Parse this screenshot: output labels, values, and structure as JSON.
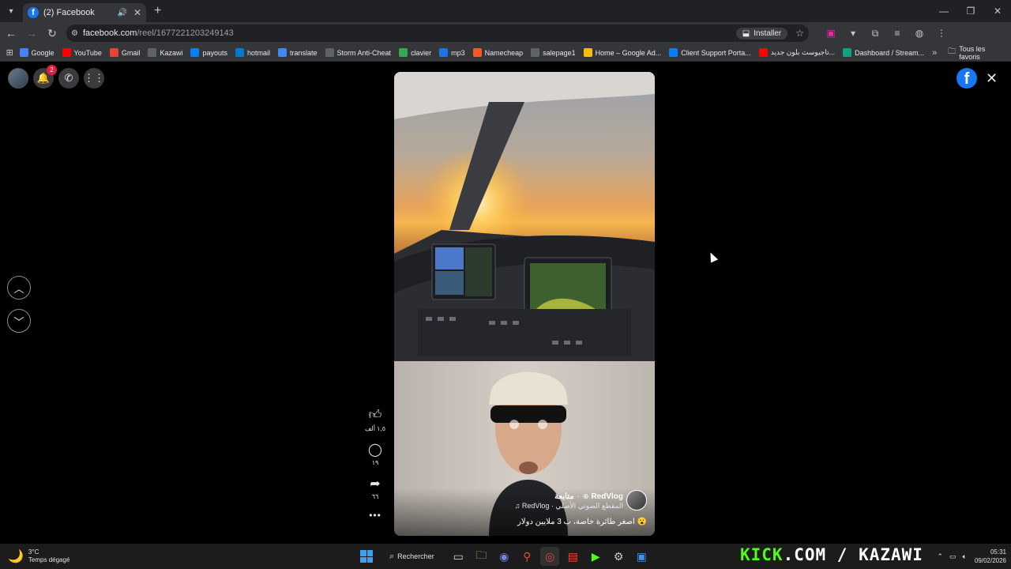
{
  "browser": {
    "tab_title": "(2) Facebook",
    "url_domain": "facebook.com",
    "url_path": "/reel/1677221203249143",
    "install_label": "Installer"
  },
  "bookmarks": {
    "items": [
      {
        "label": "Google",
        "color": "#4285f4"
      },
      {
        "label": "YouTube",
        "color": "#ff0000"
      },
      {
        "label": "Gmail",
        "color": "#ea4335"
      },
      {
        "label": "Kazawi",
        "color": "#5f6368"
      },
      {
        "label": "payouts",
        "color": "#0081fb"
      },
      {
        "label": "hotmail",
        "color": "#0078d4"
      },
      {
        "label": "translate",
        "color": "#4285f4"
      },
      {
        "label": "Storm Anti-Cheat",
        "color": "#5f6368"
      },
      {
        "label": "clavier",
        "color": "#34a853"
      },
      {
        "label": "mp3",
        "color": "#1a73e8"
      },
      {
        "label": "Namecheap",
        "color": "#ff5722"
      },
      {
        "label": "salepage1",
        "color": "#5f6368"
      },
      {
        "label": "Home – Google Ad...",
        "color": "#fbbc04"
      },
      {
        "label": "Client Support Porta...",
        "color": "#0081fb"
      },
      {
        "label": "تاجيوست بلون جديد...",
        "color": "#ff0000"
      },
      {
        "label": "Dashboard / Stream...",
        "color": "#10a37f"
      }
    ],
    "all_label": "Tous les favoris"
  },
  "facebook": {
    "notification_count": "2"
  },
  "reel": {
    "likes": "١,٥ ألف",
    "comments": "١٩",
    "shares": "٦٦",
    "author": "RedVlog",
    "follow": "متابعة",
    "audio": "RedVlog · المقطع الصوتي الأصلي",
    "caption": "اصغر طائرة خاصة، ب 3 ملايين دولار 😮"
  },
  "taskbar": {
    "temperature": "3°C",
    "weather": "Temps dégagé",
    "search_label": "Rechercher",
    "watermark_a": "KICK",
    "watermark_b": ".COM / KAZAWI",
    "time": "05:31",
    "date": "09/02/2026"
  }
}
